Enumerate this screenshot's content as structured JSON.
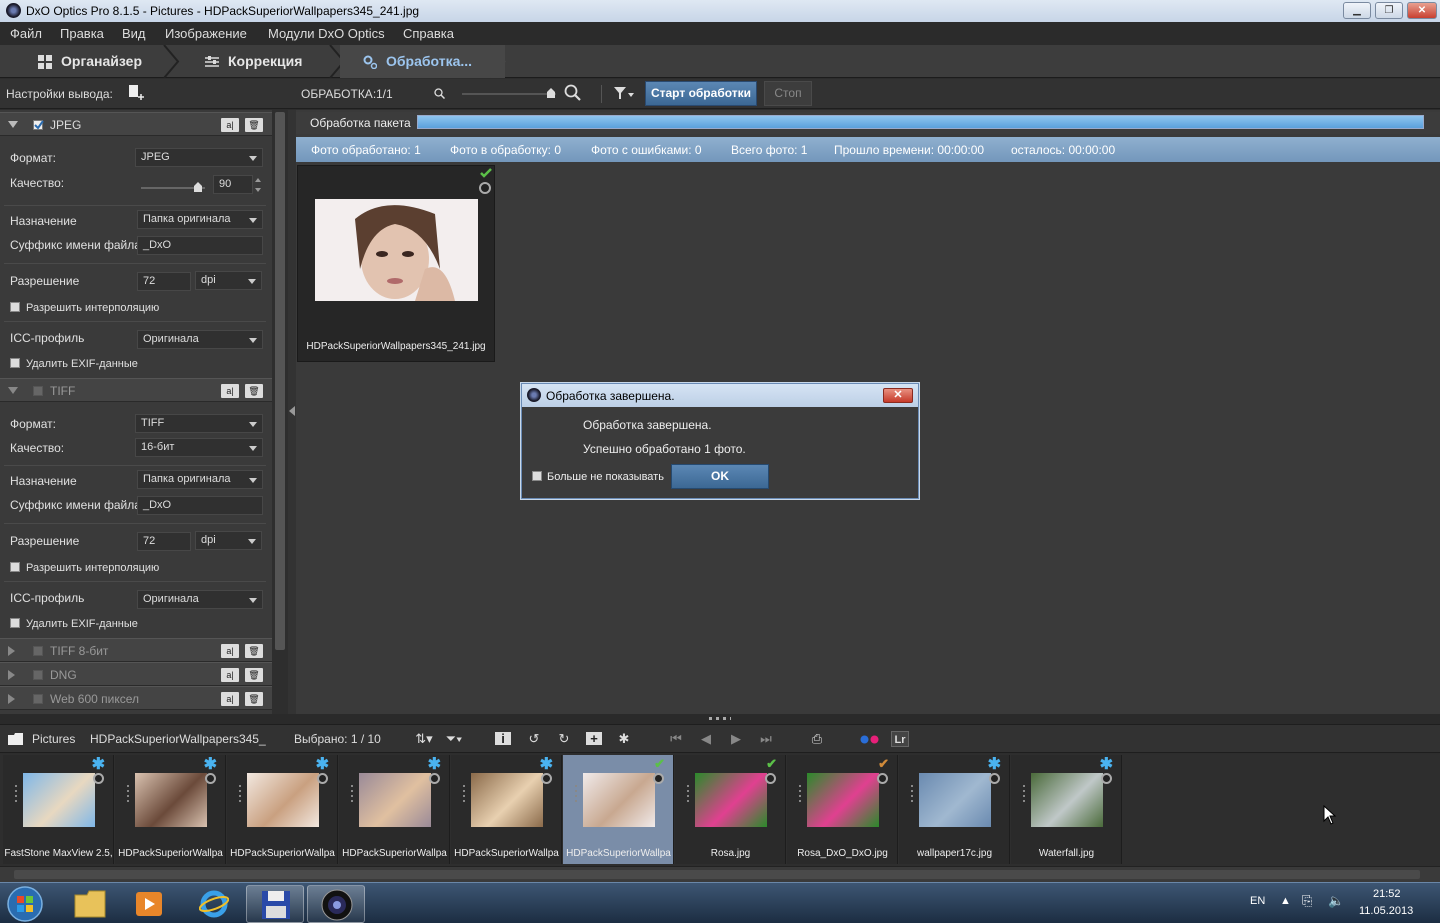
{
  "window": {
    "title": "DxO Optics Pro 8.1.5 - Pictures - HDPackSuperiorWallpapers345_241.jpg",
    "min": "▁",
    "max": "❐",
    "close": "✕"
  },
  "menu": [
    "Файл",
    "Правка",
    "Вид",
    "Изображение",
    "Модули DxO Optics",
    "Справка"
  ],
  "tabs": [
    {
      "label": "Органайзер",
      "icon": "grid-icon"
    },
    {
      "label": "Коррекция",
      "icon": "sliders-icon"
    },
    {
      "label": "Обработка...",
      "icon": "gears-icon"
    }
  ],
  "toolbar": {
    "output_settings": "Настройки вывода:",
    "processing": "ОБРАБОТКА:",
    "processing_count": "1/1",
    "start": "Старт обработки",
    "stop": "Стоп"
  },
  "output_panel": {
    "jpeg": {
      "name": "JPEG",
      "format_label": "Формат:",
      "format_value": "JPEG",
      "quality_label": "Качество:",
      "quality_value": "90",
      "dest_label": "Назначение",
      "dest_value": "Папка оригинала",
      "suffix_label": "Суффикс имени файла",
      "suffix_value": "_DxO",
      "res_label": "Разрешение",
      "res_value": "72",
      "res_unit": "dpi",
      "interp": "Разрешить интерполяцию",
      "icc_label": "ICC-профиль",
      "icc_value": "Оригинала",
      "exif": "Удалить EXIF-данные"
    },
    "tiff": {
      "name": "TIFF",
      "format_label": "Формат:",
      "format_value": "TIFF",
      "quality_label": "Качество:",
      "quality_value": "16-бит",
      "dest_label": "Назначение",
      "dest_value": "Папка оригинала",
      "suffix_label": "Суффикс имени файла",
      "suffix_value": "_DxO",
      "res_label": "Разрешение",
      "res_value": "72",
      "res_unit": "dpi",
      "interp": "Разрешить интерполяцию",
      "icc_label": "ICC-профиль",
      "icc_value": "Оригинала",
      "exif": "Удалить EXIF-данные"
    },
    "collapsed": [
      "TIFF 8-бит",
      "DNG",
      "Web 600 пиксел"
    ]
  },
  "batch": {
    "title": "Обработка пакета",
    "progress": 1.0,
    "stats": [
      "Фото обработано: 1",
      "Фото в обработку: 0",
      "Фото с ошибками: 0",
      "Всего фото: 1",
      "Прошло времени: 00:00:00",
      "осталось: 00:00:00"
    ],
    "thumb_caption": "HDPackSuperiorWallpapers345_241.jpg"
  },
  "dialog": {
    "title": "Обработка завершена.",
    "line1": "Обработка завершена.",
    "line2": "Успешно обработано 1 фото.",
    "dont_show": "Больше не показывать",
    "ok": "OK"
  },
  "browser": {
    "folder": "Pictures",
    "file": "HDPackSuperiorWallpapers345_",
    "selected": "Выбрано: 1 / 10",
    "lr": "Lr"
  },
  "filmstrip": [
    {
      "caption": "FastStone MaxView 2.5,",
      "badge": "star",
      "colors": [
        "#7fb7e8",
        "#e8d8c0"
      ]
    },
    {
      "caption": "HDPackSuperiorWallpa",
      "badge": "star",
      "colors": [
        "#d9c2b0",
        "#6b4a3a"
      ]
    },
    {
      "caption": "HDPackSuperiorWallpa",
      "badge": "star",
      "colors": [
        "#f2e8e0",
        "#c9a080"
      ]
    },
    {
      "caption": "HDPackSuperiorWallpa",
      "badge": "star",
      "colors": [
        "#9a8a98",
        "#e0c0a0"
      ]
    },
    {
      "caption": "HDPackSuperiorWallpa",
      "badge": "star",
      "colors": [
        "#8a6a4a",
        "#e8d0b0"
      ]
    },
    {
      "caption": "HDPackSuperiorWallpa",
      "badge": "check",
      "colors": [
        "#f0eaea",
        "#c8a890"
      ],
      "selected": true
    },
    {
      "caption": "Rosa.jpg",
      "badge": "check",
      "colors": [
        "#2a8a2a",
        "#e04090"
      ]
    },
    {
      "caption": "Rosa_DxO_DxO.jpg",
      "badge": "check-orange",
      "colors": [
        "#2a8a2a",
        "#e04090"
      ]
    },
    {
      "caption": "wallpaper17c.jpg",
      "badge": "star",
      "colors": [
        "#6a8ab0",
        "#a0b8d0"
      ]
    },
    {
      "caption": "Waterfall.jpg",
      "badge": "star",
      "colors": [
        "#4a6a3a",
        "#c0c8c8"
      ]
    }
  ],
  "taskbar": {
    "lang": "EN",
    "time": "21:52",
    "date": "11.05.2013"
  }
}
